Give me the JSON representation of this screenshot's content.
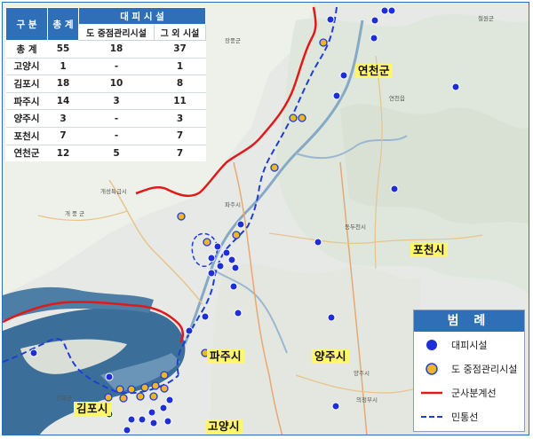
{
  "table": {
    "header": {
      "category": "구 분",
      "total": "총 계",
      "group": "대 피 시 설",
      "sub_managed": "도 중점관리시설",
      "sub_other": "그 외 시설"
    },
    "rows": [
      {
        "region": "총 계",
        "total": "55",
        "managed": "18",
        "other": "37"
      },
      {
        "region": "고양시",
        "total": "1",
        "managed": "-",
        "other": "1"
      },
      {
        "region": "김포시",
        "total": "18",
        "managed": "10",
        "other": "8"
      },
      {
        "region": "파주시",
        "total": "14",
        "managed": "3",
        "other": "11"
      },
      {
        "region": "양주시",
        "total": "3",
        "managed": "-",
        "other": "3"
      },
      {
        "region": "포천시",
        "total": "7",
        "managed": "-",
        "other": "7"
      },
      {
        "region": "연천군",
        "total": "12",
        "managed": "5",
        "other": "7"
      }
    ]
  },
  "regions": {
    "yeoncheon": "연천군",
    "pocheon": "포천시",
    "paju": "파주시",
    "yangju": "양주시",
    "gimpo": "김포시",
    "goyang": "고양시"
  },
  "legend": {
    "title": "범 례",
    "shelter": "대피시설",
    "managed": "도 중점관리시설",
    "mdl": "군사분계선",
    "cclLine": "민통선"
  },
  "colors": {
    "shelter": "#1f2fd6",
    "managed": "#f0b429",
    "mdl": "#e01a1a",
    "ccl": "#1f3fd0",
    "header": "#2f6fb7",
    "water": "#3b6f9a",
    "label_bg": "#fff56e"
  }
}
